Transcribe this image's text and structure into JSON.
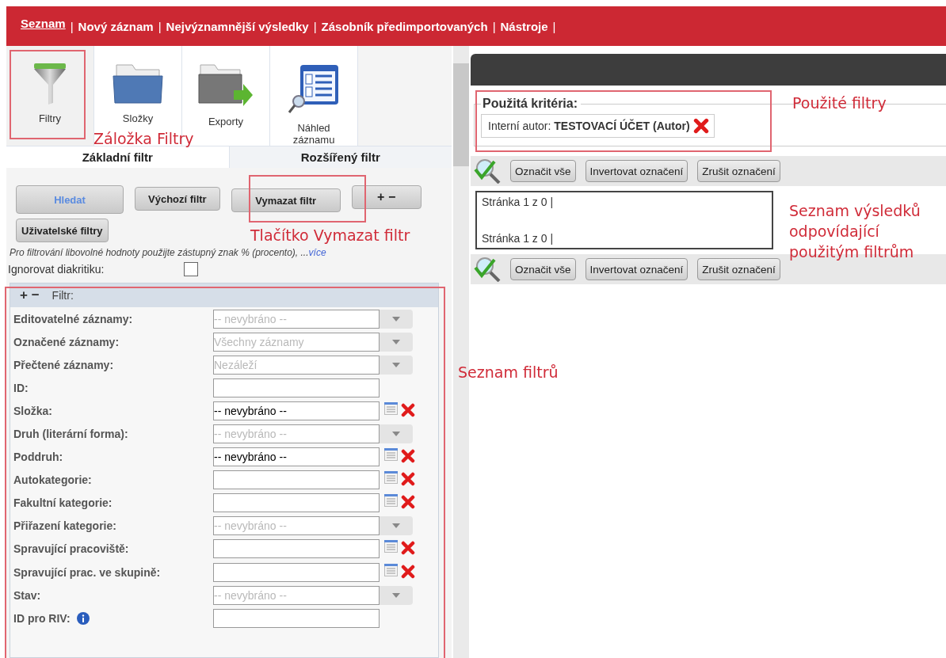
{
  "nav": {
    "separator": "|",
    "items": [
      {
        "label": "Seznam",
        "selected": true
      },
      {
        "label": "Nový záznam",
        "selected": false
      },
      {
        "label": "Nejvýznamnější výsledky",
        "selected": false
      },
      {
        "label": "Zásobník předimportovaných",
        "selected": false
      },
      {
        "label": "Nástroje",
        "selected": false
      }
    ]
  },
  "toolbar": [
    {
      "label": "Filtry",
      "kind": "filter",
      "selected": true
    },
    {
      "label": "Složky",
      "kind": "folder",
      "selected": false
    },
    {
      "label": "Exporty",
      "kind": "export",
      "selected": false
    },
    {
      "label": "Náhled záznamu",
      "kind": "preview",
      "selected": false
    }
  ],
  "tabs": [
    {
      "label": "Základní filtr",
      "selected": true
    },
    {
      "label": "Rozšířený filtr",
      "selected": false
    }
  ],
  "buttons": [
    {
      "label": "Hledat",
      "kind": "primary"
    },
    {
      "label": "Výchozí filtr",
      "kind": "normal"
    },
    {
      "label": "Vymazat filtr",
      "kind": "normal"
    },
    {
      "label": "+ −",
      "kind": "normal"
    },
    {
      "label": "Uživatelské filtry",
      "kind": "normal"
    }
  ],
  "hint": {
    "text": "Pro filtrování libovolné hodnoty použijte zástupný znak % (procento), ...",
    "link": "více"
  },
  "ignore_diacritics": {
    "label": "Ignorovat diakritiku:",
    "checked": false
  },
  "filter_panel": {
    "toggle": "+ −",
    "title": "Filtr:",
    "rows": [
      {
        "label": "Editovatelné záznamy:",
        "kind": "select",
        "value": "-- nevybráno --",
        "info": false
      },
      {
        "label": "Označené záznamy:",
        "kind": "select",
        "value": "Všechny záznamy",
        "info": false
      },
      {
        "label": "Přečtené záznamy:",
        "kind": "select",
        "value": "Nezáleží",
        "info": false
      },
      {
        "label": "ID:",
        "kind": "text",
        "info": false
      },
      {
        "label": "Složka:",
        "kind": "picker",
        "value": "-- nevybráno --",
        "info": false
      },
      {
        "label": "Druh (literární forma):",
        "kind": "select",
        "value": "-- nevybráno --",
        "info": false
      },
      {
        "label": "Poddruh:",
        "kind": "picker",
        "value": "-- nevybráno --",
        "info": false
      },
      {
        "label": "Autokategorie:",
        "kind": "picker",
        "info": false
      },
      {
        "label": "Fakultní kategorie:",
        "kind": "picker",
        "info": false
      },
      {
        "label": "Přiřazení kategorie:",
        "kind": "select",
        "value": "-- nevybráno --",
        "info": false
      },
      {
        "label": "Spravující pracoviště:",
        "kind": "picker",
        "info": false
      },
      {
        "label": "Spravující prac. ve skupině:",
        "kind": "picker",
        "info": false
      },
      {
        "label": "Stav:",
        "kind": "select",
        "value": "-- nevybráno --",
        "info": false
      },
      {
        "label": "ID pro RIV:",
        "kind": "text",
        "info": true
      }
    ]
  },
  "criteria": {
    "title": "Použitá kritéria:",
    "items": [
      {
        "text": "Interní autor: **TESTOVACÍ ÚČET (Autor)**"
      }
    ]
  },
  "selection_bars": [
    {
      "buttons": [
        "Označit vše",
        "Invertovat označení",
        "Zrušit označení"
      ]
    },
    {
      "buttons": [
        "Označit vše",
        "Invertovat označení",
        "Zrušit označení"
      ]
    }
  ],
  "results": {
    "pagers": [
      "Stránka 1 z 0 |",
      "Stránka 1 z 0 |"
    ]
  },
  "annotations": [
    {
      "text": "Záložka Filtry"
    },
    {
      "text": "Tlačítko Vymazat filtr"
    },
    {
      "text": "Seznam filtrů"
    },
    {
      "text": "Použité filtry"
    },
    {
      "text": "Seznam výsledků odpovídající použitým filtrům"
    }
  ]
}
